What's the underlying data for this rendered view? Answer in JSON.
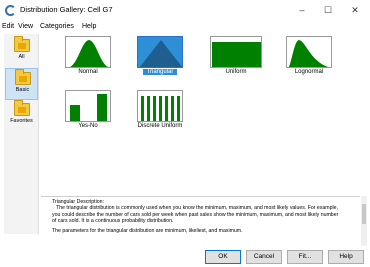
{
  "window": {
    "title": "Distribution Gallery: Cell G7",
    "minimize_glyph": "–",
    "maximize_glyph": "☐",
    "close_glyph": "✕",
    "app_icon": "crystal-ball-icon"
  },
  "menu": [
    "Edit",
    "View",
    "Categories",
    "Help"
  ],
  "sidebar": {
    "items": [
      {
        "label": "All",
        "icon": "folder-icon",
        "selected": false
      },
      {
        "label": "Basic",
        "icon": "folder-icon",
        "selected": true
      },
      {
        "label": "Favorites",
        "icon": "folder-icon",
        "selected": false
      }
    ]
  },
  "gallery": {
    "tiles": [
      {
        "label": "Normal",
        "shape": "normal",
        "selected": false
      },
      {
        "label": "Triangular",
        "shape": "triangular",
        "selected": true
      },
      {
        "label": "Uniform",
        "shape": "uniform",
        "selected": false
      },
      {
        "label": "Lognormal",
        "shape": "lognormal",
        "selected": false
      },
      {
        "label": "Yes-No",
        "shape": "yes-no",
        "selected": false
      },
      {
        "label": "Discrete Uniform",
        "shape": "discrete-uniform",
        "selected": false
      }
    ],
    "accent_color": "#008000",
    "selection_color": "#2e8fd6"
  },
  "description": {
    "lines": [
      "Triangular Description:",
      "The triangular distribution is commonly used when you know the minimum, maximum, and most likely values. For example,",
      "you could describe the number of cars sold per week when past sales show the minimum, maximum, and most likely number",
      "of cars sold. It is a continuous probability distribution.",
      "",
      "The parameters for the triangular distribution are minimum, likeliest, and maximum.",
      ""
    ]
  },
  "buttons": {
    "ok": "OK",
    "cancel": "Cancel",
    "fit": "Fit...",
    "help": "Help"
  }
}
